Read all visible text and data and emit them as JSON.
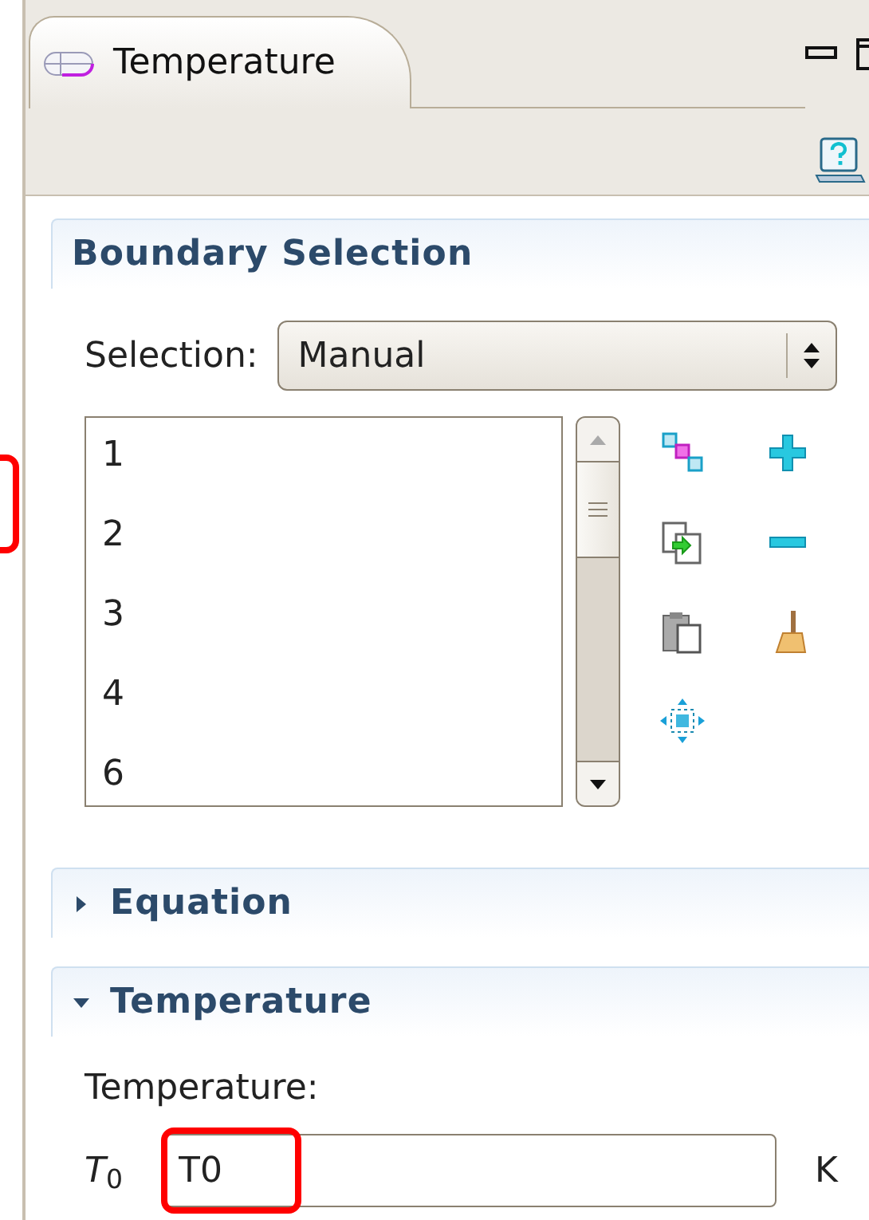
{
  "tab": {
    "title": "Temperature",
    "selected": true
  },
  "sections": [
    {
      "title": "Boundary Selection",
      "kind": "selection",
      "selection_label": "Selection:",
      "selection_value": "Manual",
      "items": [
        "1",
        "2",
        "3",
        "4",
        "6"
      ]
    },
    {
      "title": "Equation",
      "kind": "collapsed",
      "expanded": false
    },
    {
      "title": "Temperature",
      "kind": "input",
      "expanded": true,
      "label": "Temperature:",
      "symbol": "*T*$_{0}$",
      "value": "T0",
      "unit": "K"
    }
  ]
}
